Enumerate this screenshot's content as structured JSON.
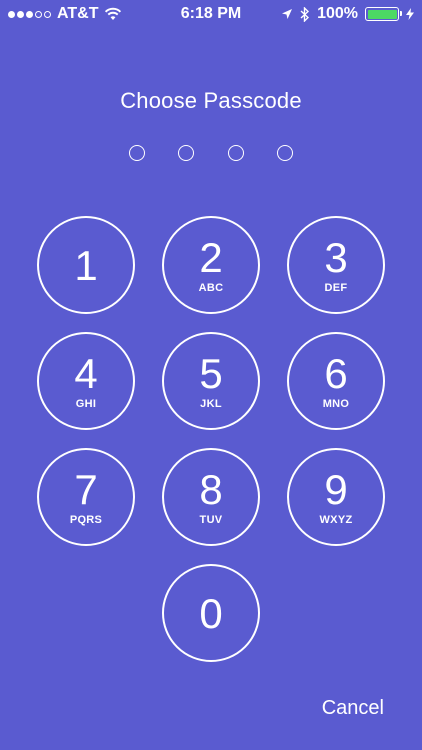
{
  "status_bar": {
    "carrier": "AT&T",
    "time": "6:18 PM",
    "battery_percent": "100%",
    "signal_bars_filled": 3,
    "signal_bars_total": 5,
    "battery_level": 1.0,
    "icons": [
      "wifi-icon",
      "location-arrow-icon",
      "bluetooth-icon",
      "battery-icon",
      "charging-bolt-icon"
    ],
    "battery_color": "#4cd964"
  },
  "passcode": {
    "title": "Choose Passcode",
    "entered": 0,
    "length": 4
  },
  "keypad": {
    "keys": [
      {
        "digit": "1",
        "letters": ""
      },
      {
        "digit": "2",
        "letters": "ABC"
      },
      {
        "digit": "3",
        "letters": "DEF"
      },
      {
        "digit": "4",
        "letters": "GHI"
      },
      {
        "digit": "5",
        "letters": "JKL"
      },
      {
        "digit": "6",
        "letters": "MNO"
      },
      {
        "digit": "7",
        "letters": "PQRS"
      },
      {
        "digit": "8",
        "letters": "TUV"
      },
      {
        "digit": "9",
        "letters": "WXYZ"
      },
      {
        "digit": "0",
        "letters": ""
      }
    ]
  },
  "actions": {
    "cancel_label": "Cancel"
  },
  "colors": {
    "background": "#5a5bd0",
    "foreground": "#ffffff"
  }
}
